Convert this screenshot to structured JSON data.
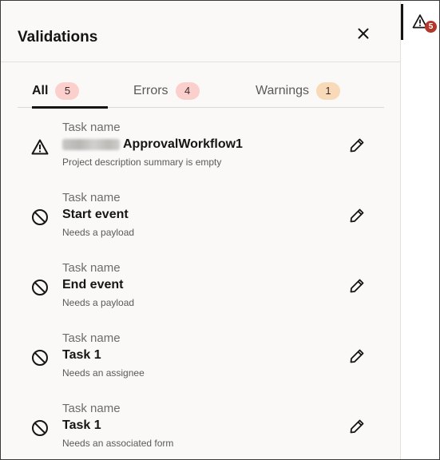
{
  "panel": {
    "title": "Validations"
  },
  "tabs": [
    {
      "label": "All",
      "count": "5"
    },
    {
      "label": "Errors",
      "count": "4"
    },
    {
      "label": "Warnings",
      "count": "1"
    }
  ],
  "items": [
    {
      "caption": "Task name",
      "name": "ApprovalWorkflow1",
      "description": "Project description summary is empty",
      "icon": "warning-icon"
    },
    {
      "caption": "Task name",
      "name": "Start event",
      "description": "Needs a payload",
      "icon": "error-icon"
    },
    {
      "caption": "Task name",
      "name": "End event",
      "description": "Needs a payload",
      "icon": "error-icon"
    },
    {
      "caption": "Task name",
      "name": "Task 1",
      "description": "Needs an assignee",
      "icon": "error-icon"
    },
    {
      "caption": "Task name",
      "name": "Task 1",
      "description": "Needs an associated form",
      "icon": "error-icon"
    }
  ],
  "side": {
    "badge_count": "5",
    "icon": "warning-icon"
  },
  "colors": {
    "error_badge": "#fbd0cc",
    "warning_badge": "#f8d9b8",
    "side_badge": "#b4372c"
  }
}
